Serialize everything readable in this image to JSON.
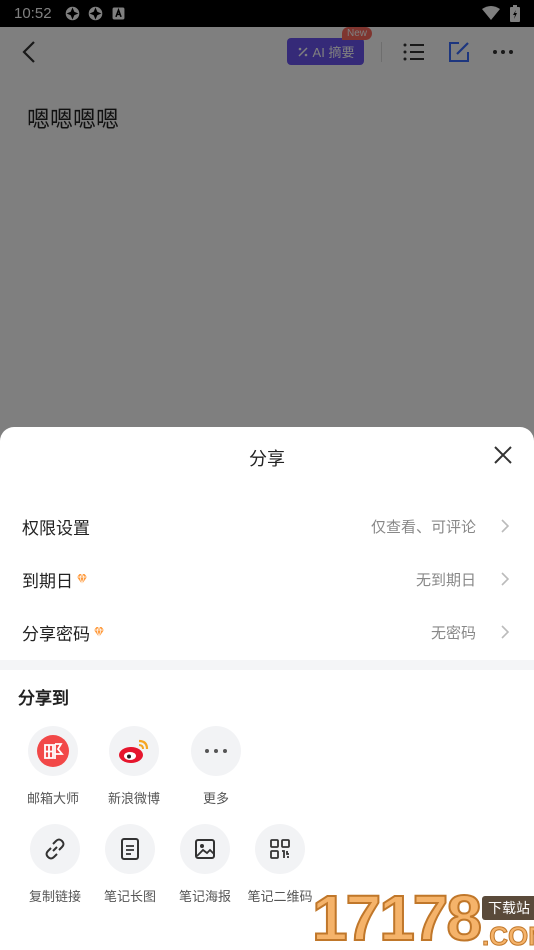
{
  "status_bar": {
    "time": "10:52"
  },
  "app": {
    "ai_button_label": "AI 摘要",
    "new_badge": "New",
    "note_title": "嗯嗯嗯嗯"
  },
  "sheet": {
    "title": "分享",
    "rows": [
      {
        "label": "权限设置",
        "value": "仅查看、可评论",
        "premium": false
      },
      {
        "label": "到期日",
        "value": "无到期日",
        "premium": true
      },
      {
        "label": "分享密码",
        "value": "无密码",
        "premium": true
      }
    ],
    "share_to_title": "分享到",
    "targets_row1": [
      {
        "label": "邮箱大师",
        "icon": "mail-master-icon"
      },
      {
        "label": "新浪微博",
        "icon": "weibo-icon"
      },
      {
        "label": "更多",
        "icon": "more-icon"
      }
    ],
    "targets_row2": [
      {
        "label": "复制链接",
        "icon": "link-icon"
      },
      {
        "label": "笔记长图",
        "icon": "long-image-icon"
      },
      {
        "label": "笔记海报",
        "icon": "poster-icon"
      },
      {
        "label": "笔记二维码",
        "icon": "qrcode-icon"
      }
    ]
  },
  "watermark": {
    "number": "17178",
    "tag": "下载站",
    "suffix": ".COM"
  },
  "colors": {
    "accent": "#6b54f0",
    "badge": "#ff6a5f",
    "premium": "#ff9a3c"
  }
}
